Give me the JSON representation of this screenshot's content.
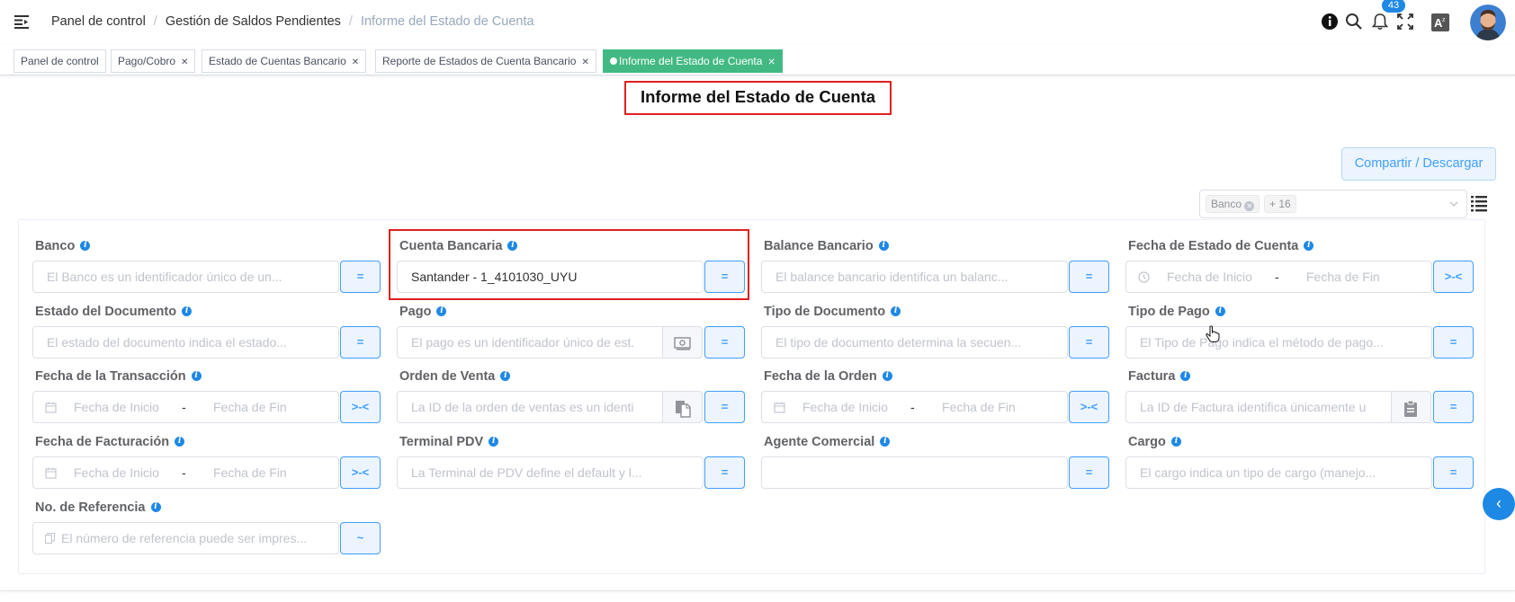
{
  "header": {
    "breadcrumb": [
      "Panel de control",
      "Gestión de Saldos Pendientes",
      "Informe del Estado de Cuenta"
    ],
    "notifications_count": "43",
    "icons": [
      "info-icon",
      "search-icon",
      "bell-icon",
      "fullscreen-icon",
      "language-icon"
    ]
  },
  "tabs": [
    {
      "label": "Panel de control",
      "closable": false,
      "active": false
    },
    {
      "label": "Pago/Cobro",
      "closable": true,
      "active": false
    },
    {
      "label": "Estado de Cuentas Bancario",
      "closable": true,
      "active": false
    },
    {
      "label": "Reporte de Estados de Cuenta Bancario",
      "closable": true,
      "active": false
    },
    {
      "label": "Informe del Estado de Cuenta",
      "closable": true,
      "active": true
    }
  ],
  "page": {
    "title": "Informe del Estado de Cuenta",
    "share_label": "Compartir / Descargar",
    "column_filter": {
      "tag": "Banco",
      "more": "+ 16"
    }
  },
  "colors": {
    "primary": "#409eff",
    "active_tab": "#42b983",
    "highlight": "#e02020"
  },
  "form": {
    "banco": {
      "label": "Banco",
      "placeholder": "El Banco es un identificador único de un...",
      "op": "="
    },
    "cuenta_bancaria": {
      "label": "Cuenta Bancaria",
      "value": "Santander - 1_4101030_UYU",
      "op": "="
    },
    "balance_bancario": {
      "label": "Balance Bancario",
      "placeholder": "El balance bancario identifica un balanc...",
      "op": "="
    },
    "fecha_estado": {
      "label": "Fecha de Estado de Cuenta",
      "start": "Fecha de Inicio",
      "end": "Fecha de Fin",
      "op": ">-<"
    },
    "estado_documento": {
      "label": "Estado del Documento",
      "placeholder": "El estado del documento indica el estado...",
      "op": "="
    },
    "pago": {
      "label": "Pago",
      "placeholder": "El pago es un identificador único de est.",
      "op": "="
    },
    "tipo_documento": {
      "label": "Tipo de Documento",
      "placeholder": "El tipo de documento determina la secuen...",
      "op": "="
    },
    "tipo_pago": {
      "label": "Tipo de Pago",
      "placeholder": "El Tipo de Pago indica el método de pago...",
      "op": "="
    },
    "fecha_transaccion": {
      "label": "Fecha de la Transacción",
      "start": "Fecha de Inicio",
      "end": "Fecha de Fin",
      "op": ">-<"
    },
    "orden_venta": {
      "label": "Orden de Venta",
      "placeholder": "La ID de la orden de ventas es un identi",
      "op": "="
    },
    "fecha_orden": {
      "label": "Fecha de la Orden",
      "start": "Fecha de Inicio",
      "end": "Fecha de Fin",
      "op": ">-<"
    },
    "factura": {
      "label": "Factura",
      "placeholder": "La ID de Factura identifica únicamente u",
      "op": "="
    },
    "fecha_facturacion": {
      "label": "Fecha de Facturación",
      "start": "Fecha de Inicio",
      "end": "Fecha de Fin",
      "op": ">-<"
    },
    "terminal_pdv": {
      "label": "Terminal PDV",
      "placeholder": "La Terminal de PDV define el default y l...",
      "op": "="
    },
    "agente_comercial": {
      "label": "Agente Comercial",
      "placeholder": "",
      "op": "="
    },
    "cargo": {
      "label": "Cargo",
      "placeholder": "El cargo indica un tipo de cargo (manejo...",
      "op": "="
    },
    "no_referencia": {
      "label": "No. de Referencia",
      "placeholder": "El número de referencia puede ser impres...",
      "op": "~"
    }
  }
}
